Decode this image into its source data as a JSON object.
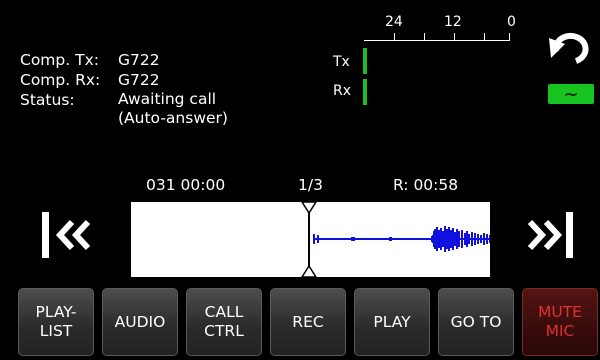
{
  "info": {
    "comp_tx_label": "Comp. Tx:",
    "comp_tx_value": "G722",
    "comp_rx_label": "Comp. Rx:",
    "comp_rx_value": "G722",
    "status_label": "Status:",
    "status_line1": "Awaiting call",
    "status_line2": "(Auto-answer)"
  },
  "meter": {
    "scale": [
      "24",
      "12",
      "0"
    ],
    "tx_label": "Tx",
    "rx_label": "Rx",
    "bar_color": "#22bb22"
  },
  "link_status": {
    "icon": "tilde-link-icon",
    "symbol": "~",
    "color": "#17c41f"
  },
  "playback": {
    "timecode": "031 00:00",
    "track_index": "1/3",
    "remaining": "R: 00:58",
    "waveform_color": "#1111dd",
    "playhead_position": 0.5
  },
  "nav": {
    "prev_icon": "skip-back-icon",
    "next_icon": "skip-forward-icon",
    "undo_icon": "undo-icon"
  },
  "buttons": {
    "playlist": "PLAY-\nLIST",
    "audio": "AUDIO",
    "call_ctrl": "CALL\nCTRL",
    "rec": "REC",
    "play": "PLAY",
    "go_to": "GO TO",
    "mute_mic": "MUTE\nMIC"
  },
  "colors": {
    "background": "#000000",
    "mute_text": "#e03030"
  }
}
